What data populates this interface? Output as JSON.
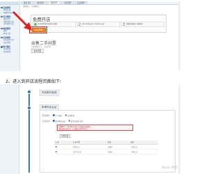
{
  "top": {
    "sidebar": {
      "groups": [
        {
          "label": "店铺管理",
          "items": [
            "我的店铺",
            "查看淘宝店铺"
          ]
        },
        {
          "label": "宝贝管理",
          "items": [
            "发布宝贝",
            "出售中的宝贝",
            "仓库中的宝贝"
          ]
        },
        {
          "label": "物流管理",
          "items": [
            "发货",
            "物流工具"
          ]
        },
        {
          "label": "交易管理",
          "items": [
            "已卖出的宝贝",
            "评价管理"
          ]
        },
        {
          "label": "客户服务",
          "items": [
            "退款管理",
            "投诉管理"
          ]
        }
      ]
    },
    "tabs": [
      "我是卖家",
      "我的淘宝",
      "免费开店",
      "宝贝管理",
      "店铺管理"
    ],
    "breadcrumb": "卖家中心 > 免费开店",
    "shop": {
      "title": "免费开店",
      "steps": [
        {
          "num": "1",
          "text": "开店条件检测 阅读开店须知"
        },
        {
          "num": "2",
          "text": "支付宝实名认证 / 淘宝开店认证"
        },
        {
          "num": "3",
          "text": "创建店铺成功 开始经营"
        }
      ],
      "button": "马上开店"
    },
    "secondhand": {
      "title": "出售二手闲置",
      "description": "出售闲置宝贝，无需开店",
      "button": "发布闲置"
    }
  },
  "instruction": "2、进入到开店流程页面如下：",
  "bottom": {
    "stage_1": "开店条件检测",
    "stage_2": "申请开店认证",
    "form": {
      "row_1_label": "开店类型：",
      "row_1_options": [
        {
          "text": "个人开店",
          "selected": true
        },
        {
          "text": "企业开店",
          "selected": false
        }
      ],
      "row_2_label": "认证方式：",
      "row_2_options": [
        {
          "text": "淘宝开店认证",
          "selected": true
        },
        {
          "text": "支付宝实名认证",
          "selected": false
        }
      ],
      "notice": [
        "温馨提示：若您所在地区已开通此认证服务，",
        "请尽快完成认证，认证通过后即可开店。"
      ],
      "verify_button": "立即认证",
      "table": {
        "headers": [
          "认证",
          "认证名称",
          "状态",
          "操作"
        ],
        "rows": [
          [
            "",
            "身份认证",
            "未通过",
            "立即认证"
          ],
          [
            "",
            "支付宝认证",
            "未通过",
            "立即认证"
          ]
        ]
      }
    }
  },
  "watermark": "Baidu 经验",
  "colors": {
    "accent": "#2f74c6",
    "orange_button": "#f08a1c",
    "highlight_red": "#e02020"
  }
}
